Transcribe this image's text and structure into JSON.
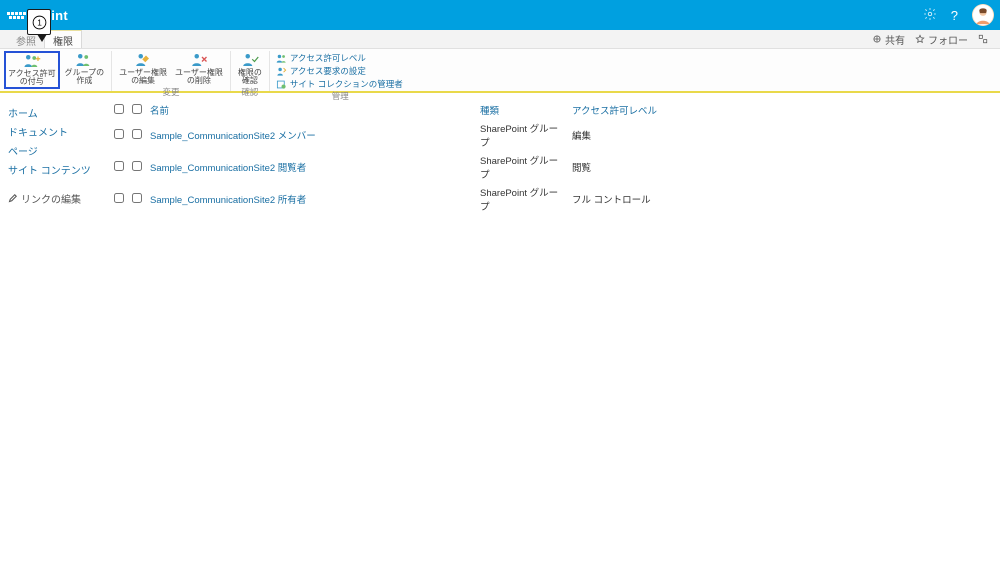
{
  "brand": "Point",
  "suite_right": {
    "share": "共有",
    "follow": "フォロー"
  },
  "callout": "①",
  "tabs": {
    "browse": "参照",
    "permissions": "権限"
  },
  "ribbon": {
    "groups": {
      "grant": {
        "btn_permissions": "アクセス許可\nの付与",
        "btn_create_group": "グループの\n作成"
      },
      "change": {
        "label": "変更",
        "btn_edit_user": "ユーザー権限\nの編集",
        "btn_remove_user": "ユーザー権限\nの削除"
      },
      "check": {
        "label": "確認",
        "btn_check": "権限の\n確認"
      },
      "manage": {
        "label": "管理",
        "item_levels": "アクセス許可レベル",
        "item_request": "アクセス要求の設定",
        "item_admins": "サイト コレクションの管理者"
      }
    }
  },
  "leftnav": {
    "items": [
      "ホーム",
      "ドキュメント",
      "ページ",
      "サイト コンテンツ"
    ],
    "edit_links": "リンクの編集"
  },
  "table": {
    "headers": {
      "name": "名前",
      "type": "種類",
      "level": "アクセス許可レベル"
    },
    "rows": [
      {
        "name": "Sample_CommunicationSite2 メンバー",
        "type": "SharePoint グループ",
        "level": "編集"
      },
      {
        "name": "Sample_CommunicationSite2 閲覧者",
        "type": "SharePoint グループ",
        "level": "閲覧"
      },
      {
        "name": "Sample_CommunicationSite2 所有者",
        "type": "SharePoint グループ",
        "level": "フル コントロール"
      }
    ]
  }
}
